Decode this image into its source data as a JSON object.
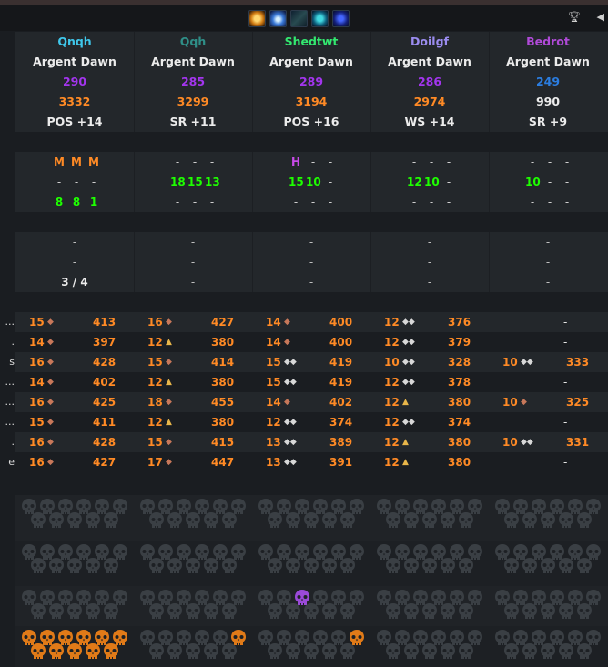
{
  "header_icons": [
    {
      "name": "sun-burst-icon",
      "color": "#e89020"
    },
    {
      "name": "frost-orb-icon",
      "color": "#3b7ad8"
    },
    {
      "name": "shadow-rune-icon",
      "color": "#3a6a70"
    },
    {
      "name": "cyan-glyph-icon",
      "color": "#41d8e0"
    },
    {
      "name": "arcane-sigil-icon",
      "color": "#4466ff"
    }
  ],
  "players": [
    {
      "name": "Qnqh",
      "name_color": "#3fc7eb",
      "realm": "Argent Dawn",
      "score": "290",
      "score_color": "#a335ee",
      "rating": "3332",
      "spec": "POS +14",
      "tier_row1": [
        "M",
        "M",
        "M"
      ],
      "tier_row2": [
        "-",
        "-",
        "-"
      ],
      "tier_row3": [
        "8",
        "8",
        "1"
      ],
      "extra": [
        "-",
        "-",
        "3 / 4"
      ]
    },
    {
      "name": "Qqh",
      "name_color": "#2f8f88",
      "realm": "Argent Dawn",
      "score": "285",
      "score_color": "#a335ee",
      "rating": "3299",
      "spec": "SR +11",
      "tier_row1": [
        "-",
        "-",
        "-"
      ],
      "tier_row2": [
        "18",
        "15",
        "13"
      ],
      "tier_row3": [
        "-",
        "-",
        "-"
      ],
      "extra": [
        "-",
        "-",
        "-"
      ]
    },
    {
      "name": "Shedtwt",
      "name_color": "#33e870",
      "realm": "Argent Dawn",
      "score": "289",
      "score_color": "#a335ee",
      "rating": "3194",
      "spec": "POS +16",
      "tier_row1": [
        "H",
        "-",
        "-"
      ],
      "tier_row2": [
        "15",
        "10",
        "-"
      ],
      "tier_row3": [
        "-",
        "-",
        "-"
      ],
      "extra": [
        "-",
        "-",
        "-"
      ]
    },
    {
      "name": "Doilgf",
      "name_color": "#9b8cf0",
      "realm": "Argent Dawn",
      "score": "286",
      "score_color": "#a335ee",
      "rating": "2974",
      "spec": "WS +14",
      "tier_row1": [
        "-",
        "-",
        "-"
      ],
      "tier_row2": [
        "12",
        "10",
        "-"
      ],
      "tier_row3": [
        "-",
        "-",
        "-"
      ],
      "extra": [
        "-",
        "-",
        "-"
      ]
    },
    {
      "name": "Bedrot",
      "name_color": "#b04ad8",
      "realm": "Argent Dawn",
      "score": "249",
      "score_color": "#2b7de0",
      "rating": "990",
      "spec": "SR +9",
      "tier_row1": [
        "-",
        "-",
        "-"
      ],
      "tier_row2": [
        "10",
        "-",
        "-"
      ],
      "tier_row3": [
        "-",
        "-",
        "-"
      ],
      "extra": [
        "-",
        "-",
        "-"
      ]
    }
  ],
  "row_labels": [
    "...",
    ".",
    "s",
    "...",
    "...",
    "...",
    ".",
    "e"
  ],
  "ilvl_rows": [
    [
      [
        "15",
        "413"
      ],
      [
        "16",
        "427"
      ],
      [
        "14",
        "400"
      ],
      [
        "12",
        "376"
      ],
      null
    ],
    [
      [
        "14",
        "397"
      ],
      [
        "12",
        "380"
      ],
      [
        "14",
        "400"
      ],
      [
        "12",
        "379"
      ],
      null
    ],
    [
      [
        "16",
        "428"
      ],
      [
        "15",
        "414"
      ],
      [
        "15",
        "419"
      ],
      [
        "10",
        "328"
      ],
      [
        "10",
        "333"
      ]
    ],
    [
      [
        "14",
        "402"
      ],
      [
        "12",
        "380"
      ],
      [
        "15",
        "419"
      ],
      [
        "12",
        "378"
      ],
      null
    ],
    [
      [
        "16",
        "425"
      ],
      [
        "18",
        "455"
      ],
      [
        "14",
        "402"
      ],
      [
        "12",
        "380"
      ],
      [
        "10",
        "325"
      ]
    ],
    [
      [
        "15",
        "411"
      ],
      [
        "12",
        "380"
      ],
      [
        "12",
        "374"
      ],
      [
        "12",
        "374"
      ],
      null
    ],
    [
      [
        "16",
        "428"
      ],
      [
        "15",
        "415"
      ],
      [
        "13",
        "389"
      ],
      [
        "12",
        "380"
      ],
      [
        "10",
        "331"
      ]
    ],
    [
      [
        "16",
        "427"
      ],
      [
        "17",
        "447"
      ],
      [
        "13",
        "391"
      ],
      [
        "12",
        "380"
      ],
      null
    ]
  ],
  "colors": {
    "orange": "#ff8a25",
    "green": "#1eff00",
    "purple_tier": "#c84ae8",
    "skull_dim": "#3a3f44",
    "skull_orange": "#e07a18",
    "skull_purple": "#9a4ad8"
  }
}
